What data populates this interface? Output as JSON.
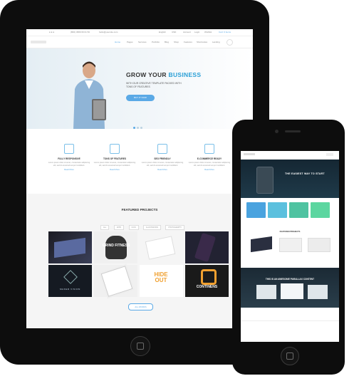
{
  "tablet": {
    "topbar": {
      "contact": "(800) 4589 69 01 50",
      "email": "hello@yoursite.com",
      "language": "English",
      "currency": "USD",
      "links": [
        "Account",
        "Login",
        "Wishlist",
        "Cart: 0 items"
      ]
    },
    "nav": [
      "Home",
      "Pages",
      "Services",
      "Portfolio",
      "Blog",
      "Shop",
      "Features",
      "Shortcodes",
      "Landing"
    ],
    "hero": {
      "title_plain": "GROW YOUR ",
      "title_accent": "BUSINESS",
      "subtitle": "WITH OUR CREATIVE TEMPLATE PACKED WITH TONS OF FEATURES",
      "button": "BUY IT NOW"
    },
    "features": [
      {
        "title": "FULLY RESPONSIVE",
        "text": "Lorem ipsum dolor sit amet, consectetur adipiscing elit, sed do eiusmod tempor incididunt.",
        "more": "Read More"
      },
      {
        "title": "TONS OF FEATURES",
        "text": "Lorem ipsum dolor sit amet, consectetur adipiscing elit, sed do eiusmod tempor incididunt.",
        "more": "Read More"
      },
      {
        "title": "SEO FRIENDLY",
        "text": "Lorem ipsum dolor sit amet, consectetur adipiscing elit, sed do eiusmod tempor incididunt.",
        "more": "Read More"
      },
      {
        "title": "E-COMMERCE READY",
        "text": "Lorem ipsum dolor sit amet, consectetur adipiscing elit, sed do eiusmod tempor incididunt.",
        "more": "Read More"
      }
    ],
    "projects": {
      "title": "FEATURED PROJECTS",
      "filters": [
        "ALL",
        "APPS",
        "ICON",
        "ILLUSTRATION",
        "PHOTOGRAPHY"
      ],
      "thumb_texts": [
        "GRIND FITNESS",
        "MAKER VISION",
        "HIDE OUT",
        "CONTINENS"
      ],
      "button": "ALL WORKS"
    }
  },
  "phone": {
    "hero_title": "THE EASIEST WAY TO START",
    "section_title": "FEATURED PROJECTS",
    "parallax_title": "THIS IS AN AWESOME PARALLAX CONTENT"
  },
  "colors": {
    "accent": "#5aa9e6",
    "device": "#0d0d0d",
    "phone_boxes": [
      "#4aa3df",
      "#5bc0de",
      "#4fc3a1",
      "#5cd6a0"
    ]
  }
}
